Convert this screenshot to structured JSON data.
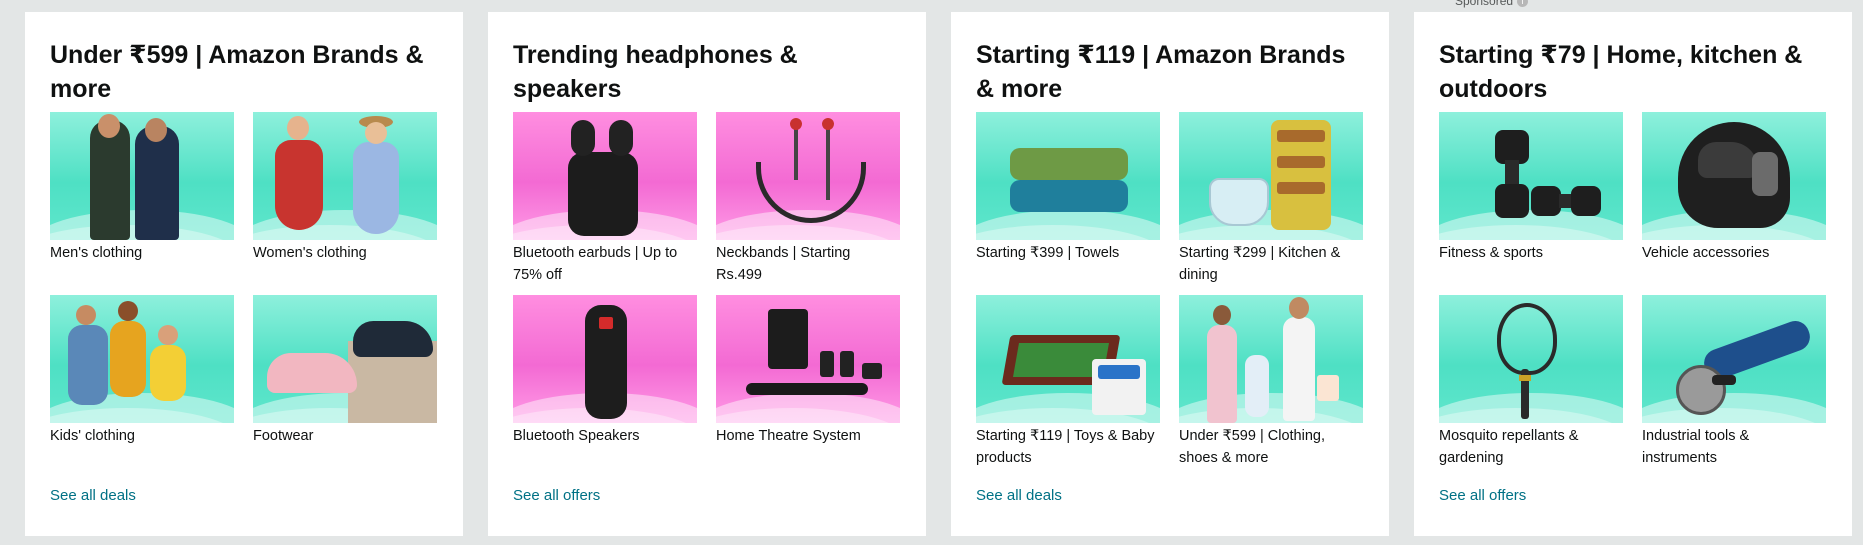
{
  "sponsored_label": "Sponsored",
  "cards": [
    {
      "title": "Under ₹599 | Amazon Brands & more",
      "link": "See all deals",
      "tiles": [
        {
          "label": "Men's clothing",
          "icon": "mens-clothing-image"
        },
        {
          "label": "Women's clothing",
          "icon": "womens-clothing-image"
        },
        {
          "label": "Kids' clothing",
          "icon": "kids-clothing-image"
        },
        {
          "label": "Footwear",
          "icon": "footwear-image"
        }
      ]
    },
    {
      "title": "Trending headphones & speakers",
      "link": "See all offers",
      "tiles": [
        {
          "label": "Bluetooth earbuds | Up to 75% off",
          "icon": "earbuds-image"
        },
        {
          "label": "Neckbands | Starting Rs.499",
          "icon": "neckband-image"
        },
        {
          "label": "Bluetooth Speakers",
          "icon": "speaker-image"
        },
        {
          "label": "Home Theatre System",
          "icon": "home-theatre-image"
        }
      ]
    },
    {
      "title": "Starting ₹119 | Amazon Brands & more",
      "link": "See all deals",
      "tiles": [
        {
          "label": "Starting ₹399 | Towels",
          "icon": "towels-image"
        },
        {
          "label": "Starting ₹299 | Kitchen & dining",
          "icon": "kitchen-image"
        },
        {
          "label": "Starting ₹119 | Toys & Baby products",
          "icon": "toys-image"
        },
        {
          "label": "Under ₹599 | Clothing, shoes & more",
          "icon": "family-clothing-image"
        }
      ]
    },
    {
      "title": "Starting ₹79 | Home, kitchen & outdoors",
      "link": "See all offers",
      "tiles": [
        {
          "label": "Fitness & sports",
          "icon": "dumbbell-image"
        },
        {
          "label": "Vehicle accessories",
          "icon": "helmet-image"
        },
        {
          "label": "Mosquito repellants & gardening",
          "icon": "mosquito-bat-image"
        },
        {
          "label": "Industrial tools & instruments",
          "icon": "angle-grinder-image"
        }
      ]
    }
  ],
  "colors": {
    "link": "#007185",
    "background": "#e3e6e6",
    "teal_tile": "#4ee0c4",
    "pink_tile": "#f36ad3"
  }
}
